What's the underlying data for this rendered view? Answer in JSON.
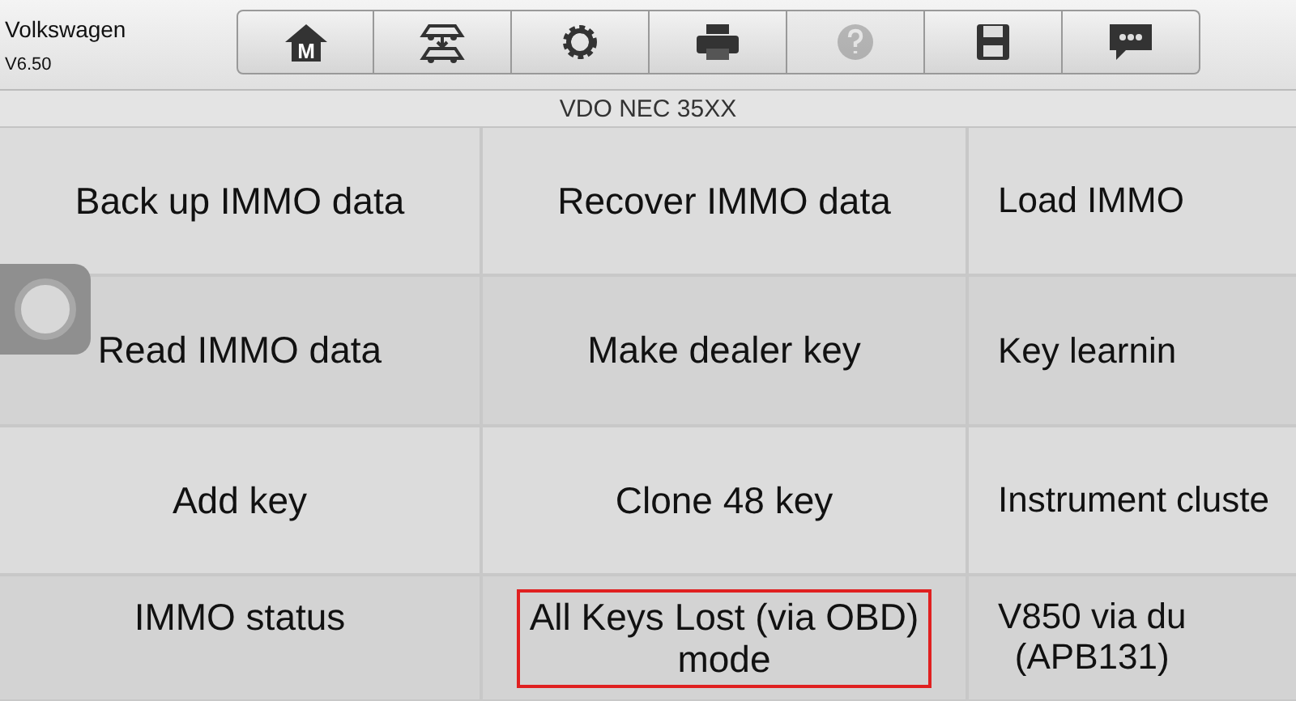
{
  "app": {
    "title": "Volkswagen",
    "version": "V6.50"
  },
  "toolbar": [
    {
      "kind": "home",
      "label": "M",
      "disabled": false
    },
    {
      "kind": "vehicle-swap",
      "disabled": false
    },
    {
      "kind": "settings",
      "disabled": false
    },
    {
      "kind": "print",
      "disabled": false
    },
    {
      "kind": "help",
      "disabled": true
    },
    {
      "kind": "save",
      "disabled": false
    },
    {
      "kind": "chat",
      "disabled": false
    }
  ],
  "subtitle": "VDO NEC 35XX",
  "functions": [
    [
      {
        "lines": [
          "Back up IMMO data"
        ],
        "selected": false
      },
      {
        "lines": [
          "Recover IMMO data"
        ],
        "selected": false
      },
      {
        "lines": [
          "Load IMMO"
        ],
        "selected": false
      }
    ],
    [
      {
        "lines": [
          "Read IMMO data"
        ],
        "selected": false
      },
      {
        "lines": [
          "Make dealer key"
        ],
        "selected": false
      },
      {
        "lines": [
          "Key learnin"
        ],
        "selected": false
      }
    ],
    [
      {
        "lines": [
          "Add key"
        ],
        "selected": false
      },
      {
        "lines": [
          "Clone 48 key"
        ],
        "selected": false
      },
      {
        "lines": [
          "Instrument cluste"
        ],
        "selected": false
      }
    ],
    [
      {
        "lines": [
          "IMMO status"
        ],
        "selected": false
      },
      {
        "lines": [
          "All Keys Lost (via OBD)",
          "mode"
        ],
        "selected": true
      },
      {
        "lines": [
          "V850 via du",
          "(APB131)"
        ],
        "selected": false
      }
    ]
  ]
}
